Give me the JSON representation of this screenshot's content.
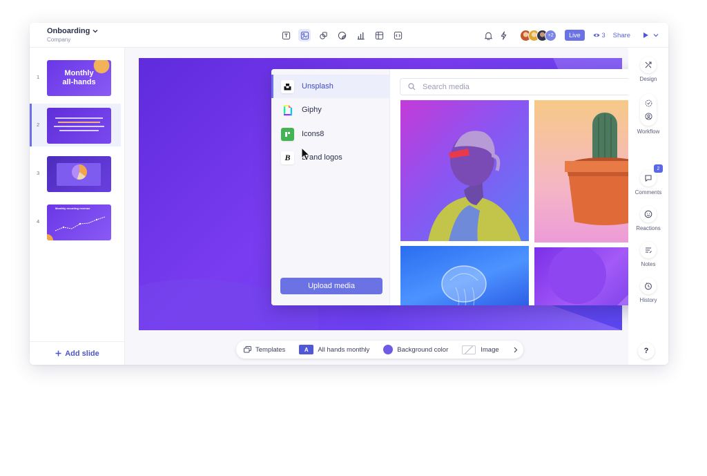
{
  "header": {
    "doc_title": "Onboarding",
    "doc_subtitle": "Company",
    "tools": [
      "text-tool-icon",
      "media-tool-icon",
      "shapes-tool-icon",
      "sticker-tool-icon",
      "chart-tool-icon",
      "table-tool-icon",
      "embed-tool-icon"
    ],
    "avatars_more": "+2",
    "live_label": "Live",
    "viewers_count": "3",
    "share_label": "Share"
  },
  "slides": {
    "items": [
      {
        "num": "1",
        "title": "Monthly all-hands"
      },
      {
        "num": "2",
        "title": ""
      },
      {
        "num": "3",
        "title": ""
      },
      {
        "num": "4",
        "title": "Monthly recurring revenue"
      }
    ],
    "add_label": "Add slide"
  },
  "media_popup": {
    "sources": [
      {
        "label": "Unsplash",
        "icon": "unsplash-icon"
      },
      {
        "label": "Giphy",
        "icon": "giphy-icon"
      },
      {
        "label": "Icons8",
        "icon": "icons8-icon"
      },
      {
        "label": "Brand logos",
        "icon": "brand-logos-icon"
      }
    ],
    "upload_label": "Upload media",
    "search_placeholder": "Search media"
  },
  "rail": {
    "items": [
      {
        "label": "Design"
      },
      {
        "label": "Workflow"
      },
      {
        "label": "Comments",
        "badge": "2"
      },
      {
        "label": "Reactions"
      },
      {
        "label": "Notes"
      },
      {
        "label": "History"
      }
    ],
    "help_label": "?"
  },
  "bottom_toolbar": {
    "templates_label": "Templates",
    "theme_badge": "A",
    "theme_label": "All hands monthly",
    "background_label": "Background color",
    "image_label": "Image"
  },
  "colors": {
    "accent": "#6b72e4",
    "slide_purple": "#6a35e8"
  }
}
